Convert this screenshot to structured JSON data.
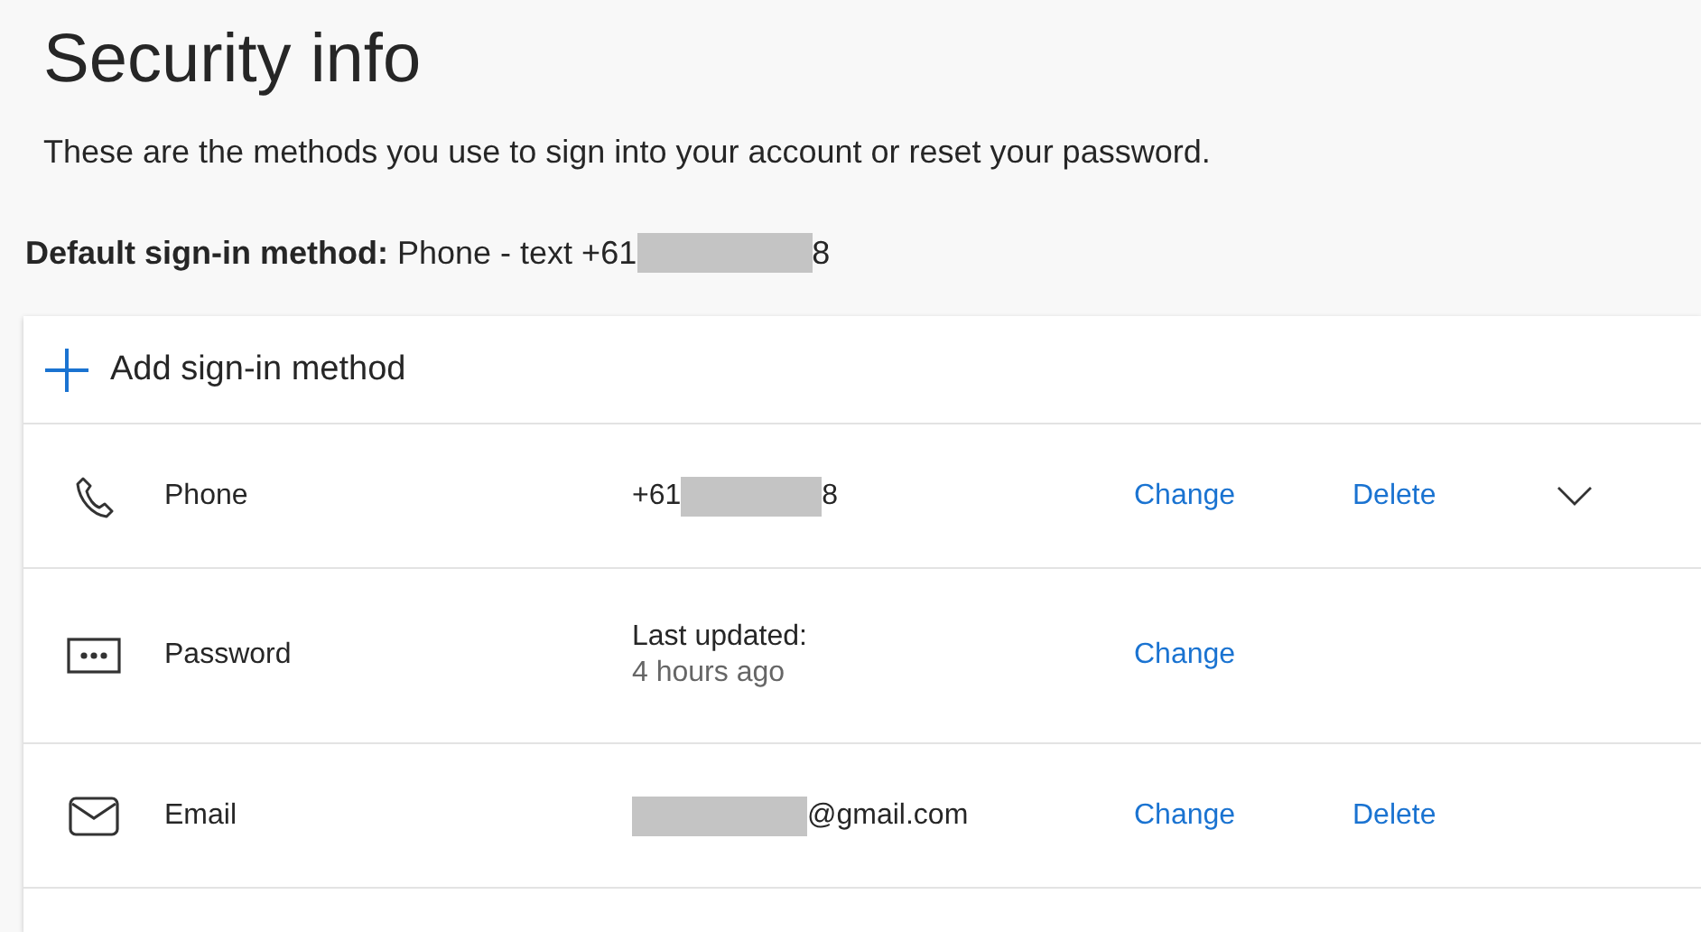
{
  "title": "Security info",
  "description": "These are the methods you use to sign into your account or reset your password.",
  "default_method": {
    "label": "Default sign-in method:",
    "value": [
      {
        "kind": "text",
        "text": "Phone - text +61"
      },
      {
        "kind": "redacted"
      },
      {
        "kind": "text",
        "text": "8"
      }
    ]
  },
  "add_button": {
    "label": "Add sign-in method"
  },
  "methods": [
    {
      "kind": "phone",
      "name": "Phone",
      "value": [
        {
          "kind": "text",
          "text": "+61"
        },
        {
          "kind": "redacted"
        },
        {
          "kind": "text",
          "text": "8"
        }
      ],
      "actions": [
        "Change",
        "Delete"
      ],
      "expandable": true
    },
    {
      "kind": "password",
      "name": "Password",
      "value": [
        {
          "kind": "text",
          "text": "Last updated:"
        }
      ],
      "detail": "4 hours ago",
      "actions": [
        "Change"
      ],
      "expandable": false
    },
    {
      "kind": "email",
      "name": "Email",
      "value": [
        {
          "kind": "redacted"
        },
        {
          "kind": "text",
          "text": "@gmail.com"
        }
      ],
      "actions": [
        "Change",
        "Delete"
      ],
      "expandable": false
    }
  ]
}
